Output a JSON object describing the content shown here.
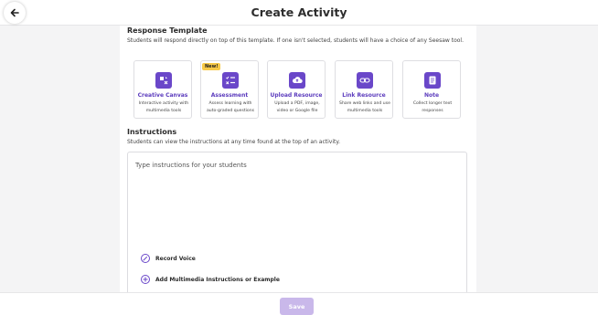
{
  "header": {
    "title": "Create Activity",
    "back_icon": "arrow-left-icon"
  },
  "response_template": {
    "title": "Response Template",
    "description": "Students will respond directly on top of this template. If one isn't selected, students will have a choice of any Seesaw tool.",
    "cards": [
      {
        "title": "Creative Canvas",
        "desc": "Interactive activity with multimedia tools",
        "icon": "canvas-icon",
        "badge": ""
      },
      {
        "title": "Assessment",
        "desc": "Assess learning with auto-graded questions",
        "icon": "checklist-icon",
        "badge": "New!"
      },
      {
        "title": "Upload Resource",
        "desc": "Upload a PDF, image, video or Google file",
        "icon": "cloud-upload-icon",
        "badge": ""
      },
      {
        "title": "Link Resource",
        "desc": "Share web links and use multimedia tools",
        "icon": "link-icon",
        "badge": ""
      },
      {
        "title": "Note",
        "desc": "Collect longer text responses",
        "icon": "note-icon",
        "badge": ""
      }
    ]
  },
  "instructions": {
    "title": "Instructions",
    "description": "Students can view the instructions at any time found at the top of an activity.",
    "placeholder": "Type instructions for your students",
    "record_voice_label": "Record Voice",
    "add_multimedia_label": "Add Multimedia Instructions or Example"
  },
  "footer": {
    "save_label": "Save"
  },
  "colors": {
    "accent": "#6a47c9",
    "accent_text": "#5b3bbd",
    "badge": "#f7c948",
    "save_disabled": "#c9b8ea"
  }
}
